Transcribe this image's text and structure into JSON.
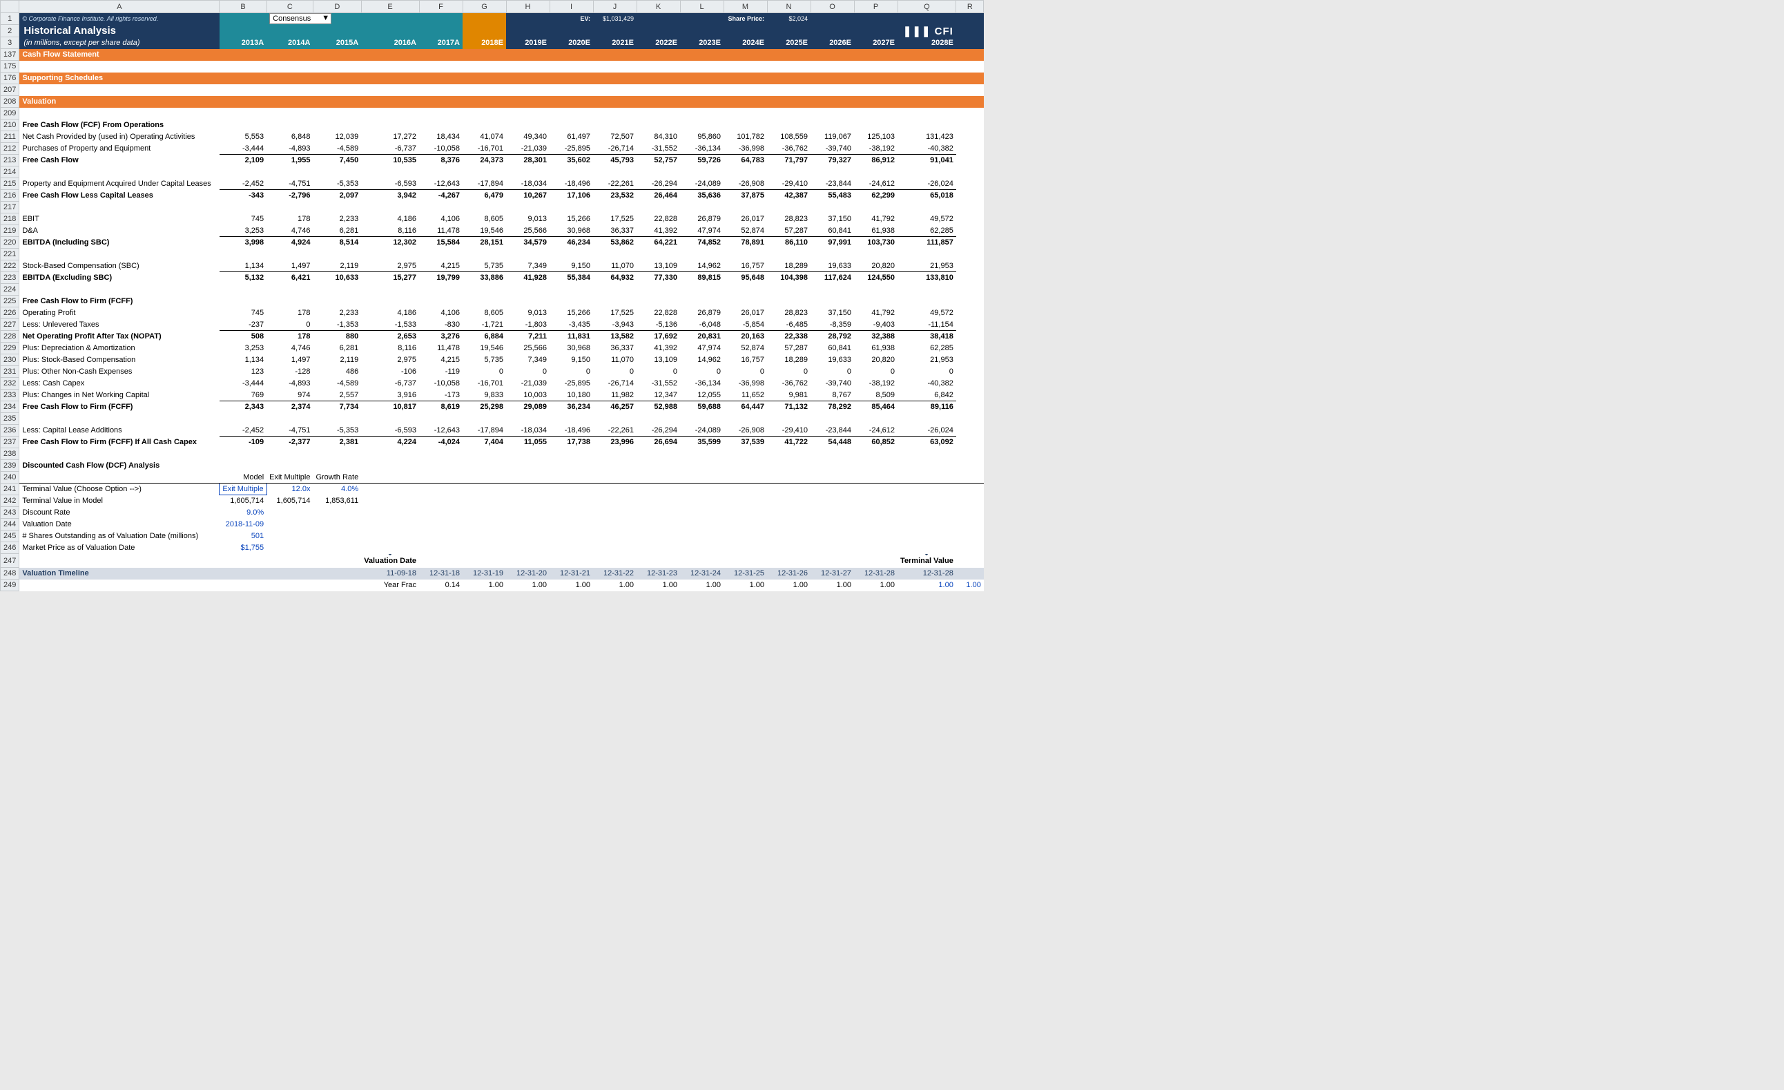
{
  "copyright": "© Corporate Finance Institute. All rights reserved.",
  "title": "Historical Analysis",
  "units": "(in millions, except per share data)",
  "dropdown_value": "Consensus",
  "ev_label": "EV:",
  "ev_value": "$1,031,429",
  "share_price_label": "Share Price:",
  "share_price_value": "$2,024",
  "logo": "❚❚❚ CFI",
  "years": [
    "2013A",
    "2014A",
    "2015A",
    "2016A",
    "2017A",
    "2018E",
    "2019E",
    "2020E",
    "2021E",
    "2022E",
    "2023E",
    "2024E",
    "2025E",
    "2026E",
    "2027E",
    "2028E"
  ],
  "sections": {
    "cfs": "Cash Flow Statement",
    "ss": "Supporting Schedules",
    "val": "Valuation"
  },
  "labels": {
    "fcf_ops": "Free Cash Flow (FCF) From Operations",
    "net_cash": "Net Cash Provided by (used in) Operating Activities",
    "ppe": "Purchases of Property and Equipment",
    "fcf": "Free Cash Flow",
    "ppe_cap": "Property and Equipment Acquired Under Capital Leases",
    "fcf_less": "Free Cash Flow Less Capital Leases",
    "ebit": "EBIT",
    "da": "D&A",
    "ebitda_inc": "EBITDA (Including SBC)",
    "sbc": "Stock-Based Compensation (SBC)",
    "ebitda_exc": "EBITDA (Excluding SBC)",
    "fcff_hdr": "Free Cash Flow to Firm (FCFF)",
    "op_profit": "Operating Profit",
    "less_tax": "Less: Unlevered Taxes",
    "nopat": "Net Operating Profit After Tax (NOPAT)",
    "plus_da": "Plus: Depreciation & Amortization",
    "plus_sbc": "Plus: Stock-Based Compensation",
    "plus_nc": "Plus: Other Non-Cash Expenses",
    "less_capex": "Less: Cash Capex",
    "plus_nwc": "Plus: Changes in Net Working Capital",
    "fcff": "Free Cash Flow to Firm (FCFF)",
    "less_cl": "Less: Capital Lease Additions",
    "fcff_all": "Free Cash Flow to Firm (FCFF) If All Cash Capex",
    "dcf": "Discounted Cash Flow (DCF) Analysis",
    "model": "Model",
    "exit_m": "Exit Multiple",
    "growth": "Growth Rate",
    "tv_choose": "Terminal Value (Choose Option -->)",
    "tv_model": "Terminal Value in Model",
    "disc_rate": "Discount Rate",
    "val_date": "Valuation Date",
    "shares": "# Shares Outstanding as of Valuation Date (millions)",
    "mkt_price": "Market Price as of Valuation Date",
    "val_date_lbl": "Valuation Date",
    "tv_lbl": "Terminal Value",
    "val_timeline": "Valuation Timeline",
    "year_frac": "Year Frac"
  },
  "model": {
    "tv_choose": "Exit Multiple",
    "exit_m": "12.0x",
    "growth": "4.0%",
    "tv_model_b": "1,605,714",
    "tv_model_c": "1,605,714",
    "tv_model_d": "1,853,611",
    "disc_rate": "9.0%",
    "val_date": "2018-11-09",
    "shares": "501",
    "mkt_price": "$1,755"
  },
  "timeline_dates": [
    "11-09-18",
    "12-31-18",
    "12-31-19",
    "12-31-20",
    "12-31-21",
    "12-31-22",
    "12-31-23",
    "12-31-24",
    "12-31-25",
    "12-31-26",
    "12-31-27",
    "12-31-28",
    "12-31-28"
  ],
  "year_frac": [
    "0.14",
    "1.00",
    "1.00",
    "1.00",
    "1.00",
    "1.00",
    "1.00",
    "1.00",
    "1.00",
    "1.00",
    "1.00",
    "1.00",
    "1.00"
  ],
  "chart_data": {
    "type": "table",
    "note": "Financial model rows; columns correspond to years 2013A–2028E",
    "rows": {
      "net_cash": [
        "5,553",
        "6,848",
        "12,039",
        "17,272",
        "18,434",
        "41,074",
        "49,340",
        "61,497",
        "72,507",
        "84,310",
        "95,860",
        "101,782",
        "108,559",
        "119,067",
        "125,103",
        "131,423"
      ],
      "ppe": [
        "-3,444",
        "-4,893",
        "-4,589",
        "-6,737",
        "-10,058",
        "-16,701",
        "-21,039",
        "-25,895",
        "-26,714",
        "-31,552",
        "-36,134",
        "-36,998",
        "-36,762",
        "-39,740",
        "-38,192",
        "-40,382"
      ],
      "fcf": [
        "2,109",
        "1,955",
        "7,450",
        "10,535",
        "8,376",
        "24,373",
        "28,301",
        "35,602",
        "45,793",
        "52,757",
        "59,726",
        "64,783",
        "71,797",
        "79,327",
        "86,912",
        "91,041"
      ],
      "ppe_cap": [
        "-2,452",
        "-4,751",
        "-5,353",
        "-6,593",
        "-12,643",
        "-17,894",
        "-18,034",
        "-18,496",
        "-22,261",
        "-26,294",
        "-24,089",
        "-26,908",
        "-29,410",
        "-23,844",
        "-24,612",
        "-26,024"
      ],
      "fcf_less": [
        "-343",
        "-2,796",
        "2,097",
        "3,942",
        "-4,267",
        "6,479",
        "10,267",
        "17,106",
        "23,532",
        "26,464",
        "35,636",
        "37,875",
        "42,387",
        "55,483",
        "62,299",
        "65,018"
      ],
      "ebit": [
        "745",
        "178",
        "2,233",
        "4,186",
        "4,106",
        "8,605",
        "9,013",
        "15,266",
        "17,525",
        "22,828",
        "26,879",
        "26,017",
        "28,823",
        "37,150",
        "41,792",
        "49,572"
      ],
      "da": [
        "3,253",
        "4,746",
        "6,281",
        "8,116",
        "11,478",
        "19,546",
        "25,566",
        "30,968",
        "36,337",
        "41,392",
        "47,974",
        "52,874",
        "57,287",
        "60,841",
        "61,938",
        "62,285"
      ],
      "ebitda_inc": [
        "3,998",
        "4,924",
        "8,514",
        "12,302",
        "15,584",
        "28,151",
        "34,579",
        "46,234",
        "53,862",
        "64,221",
        "74,852",
        "78,891",
        "86,110",
        "97,991",
        "103,730",
        "111,857"
      ],
      "sbc": [
        "1,134",
        "1,497",
        "2,119",
        "2,975",
        "4,215",
        "5,735",
        "7,349",
        "9,150",
        "11,070",
        "13,109",
        "14,962",
        "16,757",
        "18,289",
        "19,633",
        "20,820",
        "21,953"
      ],
      "ebitda_exc": [
        "5,132",
        "6,421",
        "10,633",
        "15,277",
        "19,799",
        "33,886",
        "41,928",
        "55,384",
        "64,932",
        "77,330",
        "89,815",
        "95,648",
        "104,398",
        "117,624",
        "124,550",
        "133,810"
      ],
      "op_profit": [
        "745",
        "178",
        "2,233",
        "4,186",
        "4,106",
        "8,605",
        "9,013",
        "15,266",
        "17,525",
        "22,828",
        "26,879",
        "26,017",
        "28,823",
        "37,150",
        "41,792",
        "49,572"
      ],
      "less_tax": [
        "-237",
        "0",
        "-1,353",
        "-1,533",
        "-830",
        "-1,721",
        "-1,803",
        "-3,435",
        "-3,943",
        "-5,136",
        "-6,048",
        "-5,854",
        "-6,485",
        "-8,359",
        "-9,403",
        "-11,154"
      ],
      "nopat": [
        "508",
        "178",
        "880",
        "2,653",
        "3,276",
        "6,884",
        "7,211",
        "11,831",
        "13,582",
        "17,692",
        "20,831",
        "20,163",
        "22,338",
        "28,792",
        "32,388",
        "38,418"
      ],
      "plus_da": [
        "3,253",
        "4,746",
        "6,281",
        "8,116",
        "11,478",
        "19,546",
        "25,566",
        "30,968",
        "36,337",
        "41,392",
        "47,974",
        "52,874",
        "57,287",
        "60,841",
        "61,938",
        "62,285"
      ],
      "plus_sbc": [
        "1,134",
        "1,497",
        "2,119",
        "2,975",
        "4,215",
        "5,735",
        "7,349",
        "9,150",
        "11,070",
        "13,109",
        "14,962",
        "16,757",
        "18,289",
        "19,633",
        "20,820",
        "21,953"
      ],
      "plus_nc": [
        "123",
        "-128",
        "486",
        "-106",
        "-119",
        "0",
        "0",
        "0",
        "0",
        "0",
        "0",
        "0",
        "0",
        "0",
        "0",
        "0"
      ],
      "less_capex": [
        "-3,444",
        "-4,893",
        "-4,589",
        "-6,737",
        "-10,058",
        "-16,701",
        "-21,039",
        "-25,895",
        "-26,714",
        "-31,552",
        "-36,134",
        "-36,998",
        "-36,762",
        "-39,740",
        "-38,192",
        "-40,382"
      ],
      "plus_nwc": [
        "769",
        "974",
        "2,557",
        "3,916",
        "-173",
        "9,833",
        "10,003",
        "10,180",
        "11,982",
        "12,347",
        "12,055",
        "11,652",
        "9,981",
        "8,767",
        "8,509",
        "6,842"
      ],
      "fcff": [
        "2,343",
        "2,374",
        "7,734",
        "10,817",
        "8,619",
        "25,298",
        "29,089",
        "36,234",
        "46,257",
        "52,988",
        "59,688",
        "64,447",
        "71,132",
        "78,292",
        "85,464",
        "89,116"
      ],
      "less_cl": [
        "-2,452",
        "-4,751",
        "-5,353",
        "-6,593",
        "-12,643",
        "-17,894",
        "-18,034",
        "-18,496",
        "-22,261",
        "-26,294",
        "-24,089",
        "-26,908",
        "-29,410",
        "-23,844",
        "-24,612",
        "-26,024"
      ],
      "fcff_all": [
        "-109",
        "-2,377",
        "2,381",
        "4,224",
        "-4,024",
        "7,404",
        "11,055",
        "17,738",
        "23,996",
        "26,694",
        "35,599",
        "37,539",
        "41,722",
        "54,448",
        "60,852",
        "63,092"
      ]
    }
  }
}
